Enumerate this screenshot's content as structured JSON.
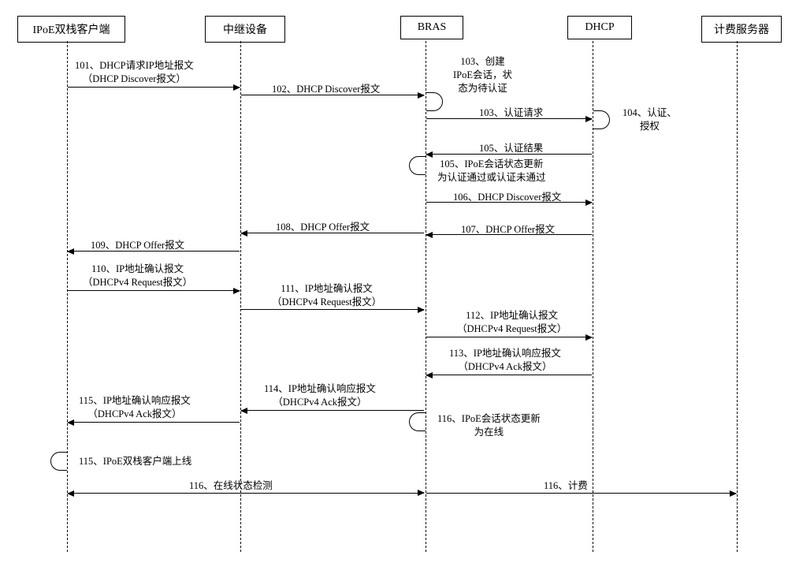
{
  "participants": {
    "client": "IPoE双栈客户端",
    "relay": "中继设备",
    "bras": "BRAS",
    "dhcp": "DHCP",
    "billing": "计费服务器"
  },
  "messages": {
    "m101_l1": "101、DHCP请求IP地址报文",
    "m101_l2": "（DHCP Discover报文）",
    "m102": "102、DHCP Discover报文",
    "m103_note_l1": "103、创建",
    "m103_note_l2": "IPoE会话，状",
    "m103_note_l3": "态为待认证",
    "m103_req": "103、认证请求",
    "m104_l1": "104、认证、",
    "m104_l2": "授权",
    "m105": "105、认证结果",
    "m105_note_l1": "105、IPoE会话状态更新",
    "m105_note_l2": "为认证通过或认证未通过",
    "m106": "106、DHCP Discover报文",
    "m107": "107、DHCP Offer报文",
    "m108": "108、DHCP  Offer报文",
    "m109": "109、DHCP Offer报文",
    "m110_l1": "110、IP地址确认报文",
    "m110_l2": "（DHCPv4 Request报文）",
    "m111_l1": "111、IP地址确认报文",
    "m111_l2": "（DHCPv4 Request报文）",
    "m112_l1": "112、IP地址确认报文",
    "m112_l2": "（DHCPv4 Request报文）",
    "m113_l1": "113、IP地址确认响应报文",
    "m113_l2": "（DHCPv4 Ack报文）",
    "m114_l1": "114、IP地址确认响应报文",
    "m114_l2": "（DHCPv4 Ack报文）",
    "m115_l1": "115、IP地址确认响应报文",
    "m115_l2": "（DHCPv4 Ack报文）",
    "m116_note_l1": "116、IPoE会话状态更新",
    "m116_note_l2": "为在线",
    "m115_client": "115、IPoE双栈客户端上线",
    "m116_online": "116、在线状态检测",
    "m116_billing": "116、计费"
  }
}
